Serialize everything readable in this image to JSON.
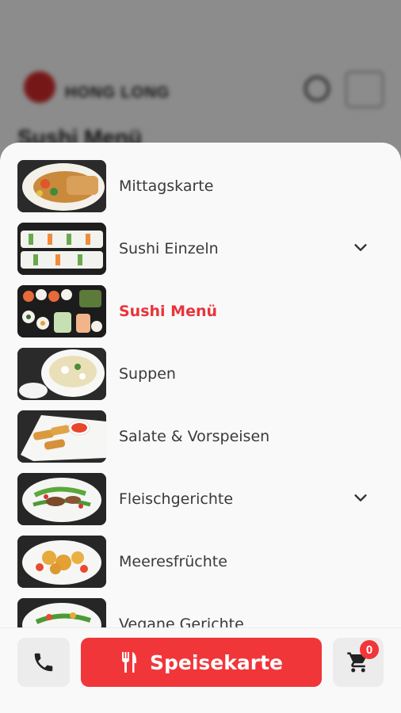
{
  "background": {
    "logo_text": "HONG LONG",
    "page_title": "Sushi Menü"
  },
  "menu": {
    "items": [
      {
        "label": "Mittagskarte",
        "image": "dish-image-mittagskarte",
        "expandable": false,
        "active": false
      },
      {
        "label": "Sushi Einzeln",
        "image": "dish-image-sushi-einzeln",
        "expandable": true,
        "active": false
      },
      {
        "label": "Sushi Menü",
        "image": "dish-image-sushi-menu",
        "expandable": false,
        "active": true
      },
      {
        "label": "Suppen",
        "image": "dish-image-suppen",
        "expandable": false,
        "active": false
      },
      {
        "label": "Salate & Vorspeisen",
        "image": "dish-image-salate",
        "expandable": false,
        "active": false
      },
      {
        "label": "Fleischgerichte",
        "image": "dish-image-fleischgerichte",
        "expandable": true,
        "active": false
      },
      {
        "label": "Meeresfrüchte",
        "image": "dish-image-meeresfruechte",
        "expandable": false,
        "active": false
      },
      {
        "label": "Vegane Gerichte",
        "image": "dish-image-vegan",
        "expandable": false,
        "active": false
      }
    ]
  },
  "bottom_bar": {
    "phone_icon": "phone-icon",
    "menu_button_label": "Speisekarte",
    "menu_button_icon": "fork-knife-icon",
    "cart_icon": "cart-icon",
    "cart_count": "0"
  },
  "colors": {
    "accent": "#f1363a",
    "active_text": "#e8343b",
    "drawer_bg": "#f9f9f9"
  }
}
